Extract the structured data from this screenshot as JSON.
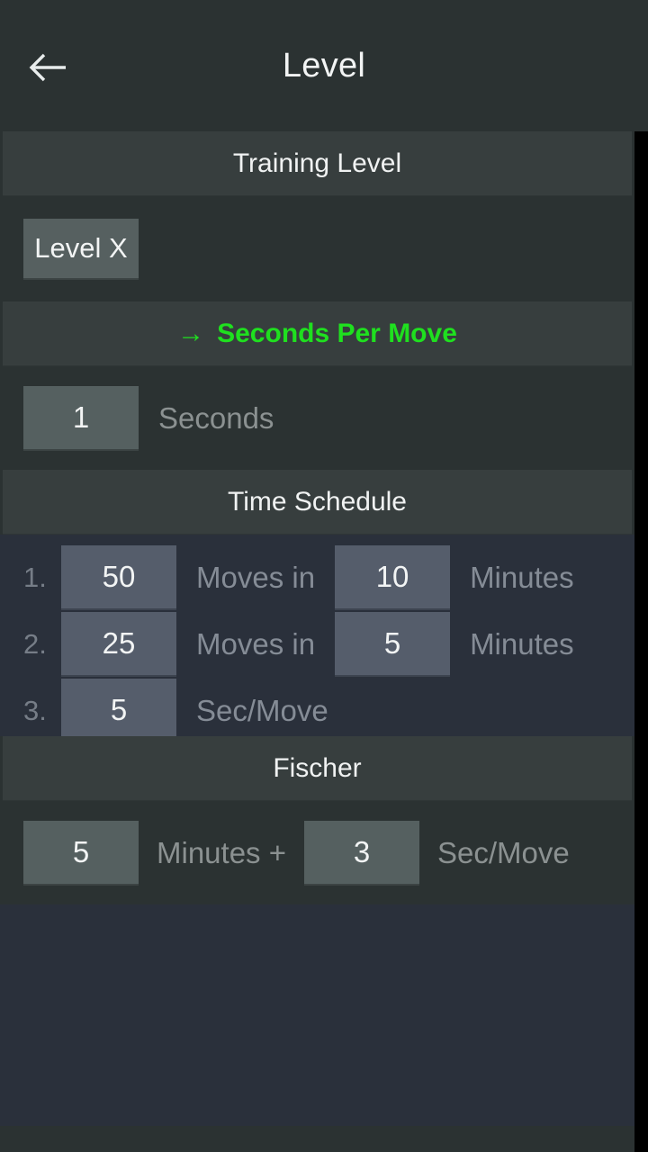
{
  "appbar": {
    "back_icon": "arrow-left-icon",
    "title": "Level"
  },
  "colors": {
    "accent_green": "#1fe01f",
    "bg_dark": "#2b3232",
    "header_bar": "#373e3e",
    "chip_green_gray": "#556060",
    "chip_blue_gray": "#555d6b",
    "text_primary": "#f2f4f4",
    "text_muted": "#8b9191",
    "scroll_track": "#000000"
  },
  "sections": {
    "training_level": {
      "header": "Training Level",
      "level_button": "Level X"
    },
    "seconds_per_move": {
      "arrow_icon": "arrow-right-icon",
      "arrow_glyph": "→",
      "header": "Seconds Per Move",
      "value": "1",
      "unit_label": "Seconds"
    },
    "time_schedule": {
      "header": "Time Schedule",
      "rows": [
        {
          "index": "1.",
          "moves": "50",
          "moves_label": "Moves in",
          "time": "10",
          "time_label": "Minutes"
        },
        {
          "index": "2.",
          "moves": "25",
          "moves_label": "Moves in",
          "time": "5",
          "time_label": "Minutes"
        },
        {
          "index": "3.",
          "moves": "5",
          "moves_label": "Sec/Move",
          "time": "",
          "time_label": ""
        }
      ]
    },
    "fischer": {
      "header": "Fischer",
      "minutes": "5",
      "minutes_label": "Minutes +",
      "increment": "3",
      "increment_label": "Sec/Move"
    }
  }
}
